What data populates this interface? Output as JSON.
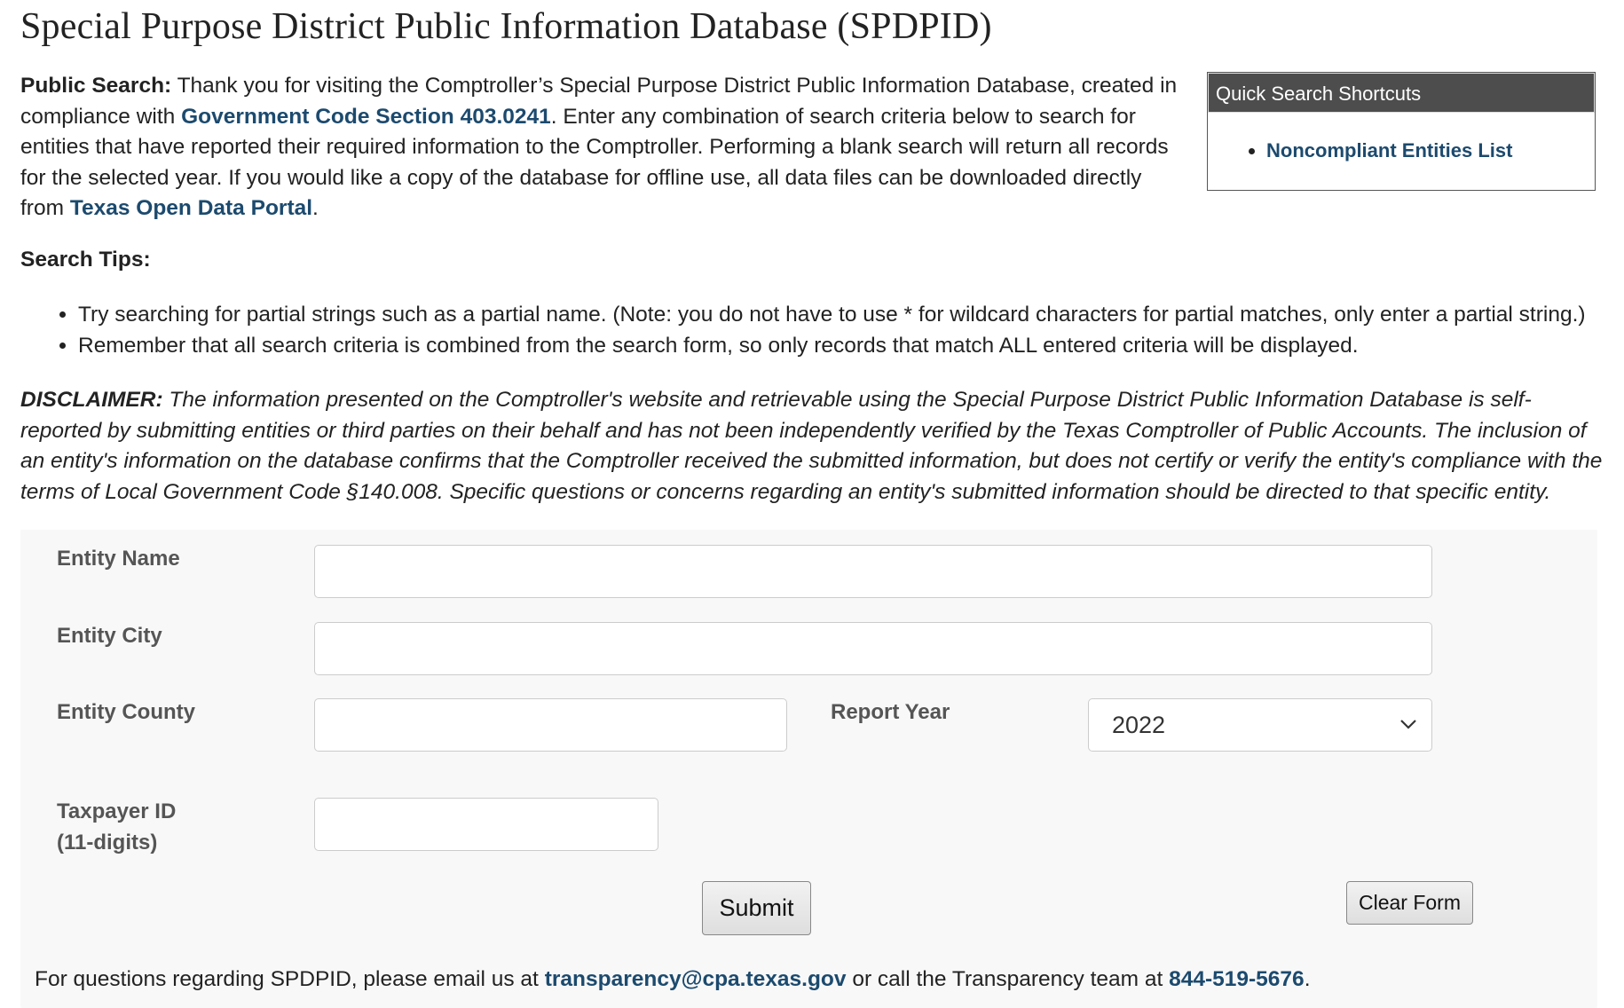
{
  "page_title": "Special Purpose District Public Information Database (SPDPID)",
  "intro": {
    "label": "Public Search:",
    "text1": " Thank you for visiting the Comptroller’s Special Purpose District Public Information Database, created in compliance with ",
    "link1": "Government Code Section 403.0241",
    "text2": ". Enter any combination of search criteria below to search for entities that have reported their required information to the Comptroller. Performing a blank search will return all records for the selected year. If you would like a copy of the database for offline use, all data files can be downloaded directly from ",
    "link2": "Texas Open Data Portal",
    "text3": "."
  },
  "quick_search": {
    "title": "Quick Search Shortcuts",
    "items": [
      "Noncompliant Entities List"
    ]
  },
  "search_tips": {
    "title": "Search Tips:",
    "items": [
      "Try searching for partial strings such as a partial name. (Note: you do not have to use * for wildcard characters for partial matches, only enter a partial string.)",
      "Remember that all search criteria is combined from the search form, so only records that match ALL entered criteria will be displayed."
    ]
  },
  "disclaimer": {
    "label": "DISCLAIMER:",
    "text": " The information presented on the Comptroller's website and retrievable using the Special Purpose District Public Information Database is self-reported by submitting entities or third parties on their behalf and has not been independently verified by the Texas Comptroller of Public Accounts. The inclusion of an entity's information on the database confirms that the Comptroller received the submitted information, but does not certify or verify the entity's compliance with the terms of Local Government Code §140.008. Specific questions or concerns regarding an entity's submitted information should be directed to that specific entity."
  },
  "form": {
    "entity_name_label": "Entity Name",
    "entity_name_value": "",
    "entity_city_label": "Entity City",
    "entity_city_value": "",
    "entity_county_label": "Entity County",
    "entity_county_value": "",
    "report_year_label": "Report Year",
    "report_year_value": "2022",
    "taxpayer_label_line1": "Taxpayer ID",
    "taxpayer_label_line2": "(11-digits)",
    "taxpayer_value": "",
    "submit_label": "Submit",
    "clear_label": "Clear Form"
  },
  "footer": {
    "text1": "For questions regarding SPDPID, please email us at ",
    "email": "transparency@cpa.texas.gov",
    "text2": " or call the Transparency team at ",
    "phone": "844-519-5676",
    "text3": "."
  },
  "colors": {
    "link": "#1c4a6e",
    "quick_header_bg": "#4d4d4d",
    "form_bg": "#f8f8f8"
  }
}
